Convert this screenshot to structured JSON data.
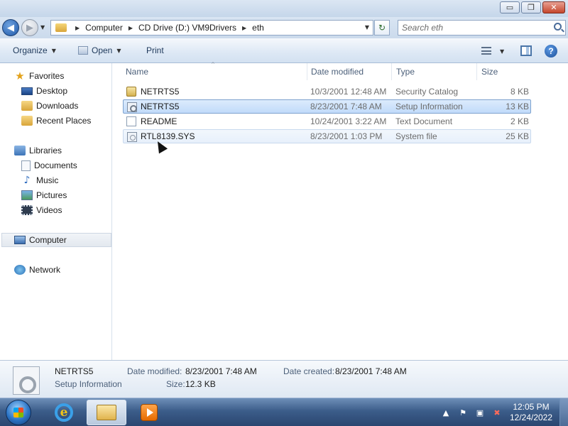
{
  "window": {
    "controls": {
      "minimize": "▭",
      "maximize": "❐",
      "close": "✕"
    }
  },
  "nav": {
    "back_glyph": "◀",
    "forward_glyph": "▶",
    "recent_glyph": "▼",
    "breadcrumb": [
      "Computer",
      "CD Drive (D:) VM9Drivers",
      "eth"
    ],
    "breadcrumb_sep": "▶",
    "address_dropdown_glyph": "▼",
    "refresh_glyph": "↻",
    "search_placeholder": "Search eth"
  },
  "commandbar": {
    "organize": "Organize",
    "open": "Open",
    "print": "Print",
    "dropdown_glyph": "▼",
    "help": "?"
  },
  "sidebar": {
    "favorites": {
      "label": "Favorites",
      "items": [
        "Desktop",
        "Downloads",
        "Recent Places"
      ]
    },
    "libraries": {
      "label": "Libraries",
      "items": [
        "Documents",
        "Music",
        "Pictures",
        "Videos"
      ]
    },
    "computer": "Computer",
    "network": "Network",
    "icons": {
      "star": "★",
      "music": "♪"
    }
  },
  "filelist": {
    "sort_caret": "^",
    "columns": [
      "Name",
      "Date modified",
      "Type",
      "Size"
    ],
    "rows": [
      {
        "name": "NETRTS5",
        "date": "10/3/2001 12:48 AM",
        "type": "Security Catalog",
        "size": "8 KB",
        "icon": "security-catalog-icon"
      },
      {
        "name": "NETRTS5",
        "date": "8/23/2001 7:48 AM",
        "type": "Setup Information",
        "size": "13 KB",
        "icon": "setup-information-icon"
      },
      {
        "name": "README",
        "date": "10/24/2001 3:22 AM",
        "type": "Text Document",
        "size": "2 KB",
        "icon": "text-document-icon"
      },
      {
        "name": "RTL8139.SYS",
        "date": "8/23/2001 1:03 PM",
        "type": "System file",
        "size": "25 KB",
        "icon": "system-file-icon"
      }
    ]
  },
  "details": {
    "name": "NETRTS5",
    "type": "Setup Information",
    "date_modified_label": "Date modified:",
    "date_modified": "8/23/2001 7:48 AM",
    "date_created_label": "Date created:",
    "date_created": "8/23/2001 7:48 AM",
    "size_label": "Size:",
    "size": "12.3 KB"
  },
  "taskbar": {
    "ie_glyph": "e",
    "tray": {
      "show_hidden": "▲",
      "flag": "⚑",
      "network": "▣",
      "volume": "✖"
    },
    "time": "12:05 PM",
    "date": "12/24/2022"
  }
}
